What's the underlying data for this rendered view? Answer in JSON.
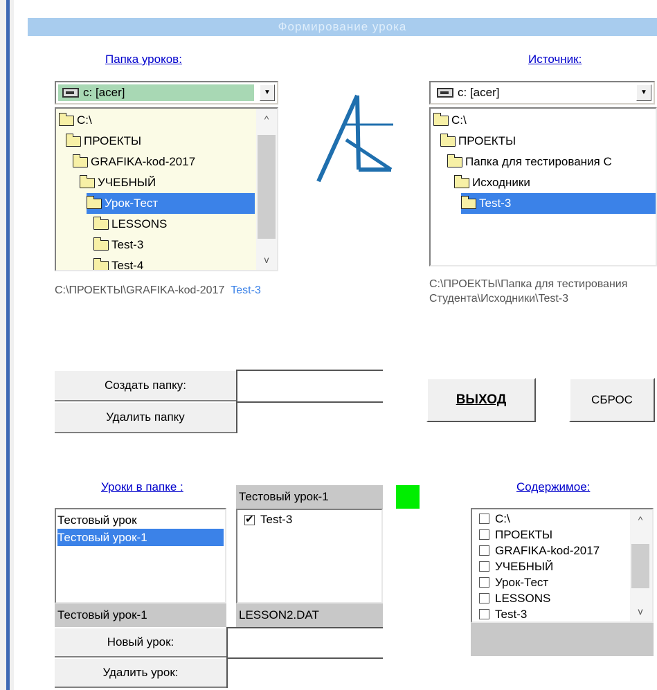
{
  "window": {
    "title": "Формирование урока"
  },
  "left_panel": {
    "label": "Папка уроков:",
    "drive": "c: [acer]",
    "tree": [
      {
        "label": "C:\\",
        "indent": 0,
        "selected": false
      },
      {
        "label": "ПРОЕКТЫ",
        "indent": 1,
        "selected": false
      },
      {
        "label": "GRAFIKA-kod-2017",
        "indent": 2,
        "selected": false
      },
      {
        "label": "УЧЕБНЫЙ",
        "indent": 3,
        "selected": false
      },
      {
        "label": "Урок-Тест",
        "indent": 4,
        "selected": true
      },
      {
        "label": "LESSONS",
        "indent": 5,
        "selected": false
      },
      {
        "label": "Test-3",
        "indent": 5,
        "selected": false
      },
      {
        "label": "Test-4",
        "indent": 5,
        "selected": false
      }
    ],
    "path": "C:\\ПРОЕКТЫ\\GRAFIKA-kod-2017",
    "path_highlight": "Test-3"
  },
  "right_panel": {
    "label": "Источник:",
    "drive": "c: [acer]",
    "tree": [
      {
        "label": "C:\\",
        "indent": 0,
        "selected": false
      },
      {
        "label": "ПРОЕКТЫ",
        "indent": 1,
        "selected": false
      },
      {
        "label": "Папка для тестирования С",
        "indent": 2,
        "selected": false
      },
      {
        "label": "Исходники",
        "indent": 3,
        "selected": false
      },
      {
        "label": "Test-3",
        "indent": 4,
        "selected": true
      }
    ],
    "path": "C:\\ПРОЕКТЫ\\Папка для тестирования Студента\\Исходники\\Test-3"
  },
  "folder_actions": {
    "create_label": "Создать папку:",
    "delete_label": "Удалить папку"
  },
  "buttons": {
    "exit": "ВЫХОД",
    "reset": "СБРОС"
  },
  "lessons": {
    "label": "Уроки в папке :",
    "items": [
      {
        "label": "Тестовый урок",
        "selected": false
      },
      {
        "label": "Тестовый урок-1",
        "selected": true
      }
    ],
    "current": "Тестовый урок-1",
    "new_label": "Новый урок:",
    "delete_label": "Удалить урок:"
  },
  "lesson_content": {
    "header": "Тестовый урок-1",
    "items": [
      {
        "label": "Test-3",
        "checked": true
      }
    ],
    "file": "LESSON2.DAT",
    "status_color": "#00ee00"
  },
  "contents": {
    "label": "Содержимое:",
    "items": [
      {
        "label": "C:\\",
        "checked": false
      },
      {
        "label": "ПРОЕКТЫ",
        "checked": false
      },
      {
        "label": "GRAFIKA-kod-2017",
        "checked": false
      },
      {
        "label": "УЧЕБНЫЙ",
        "checked": false
      },
      {
        "label": "Урок-Тест",
        "checked": false
      },
      {
        "label": "LESSONS",
        "checked": false
      },
      {
        "label": "Test-3",
        "checked": false
      }
    ]
  }
}
